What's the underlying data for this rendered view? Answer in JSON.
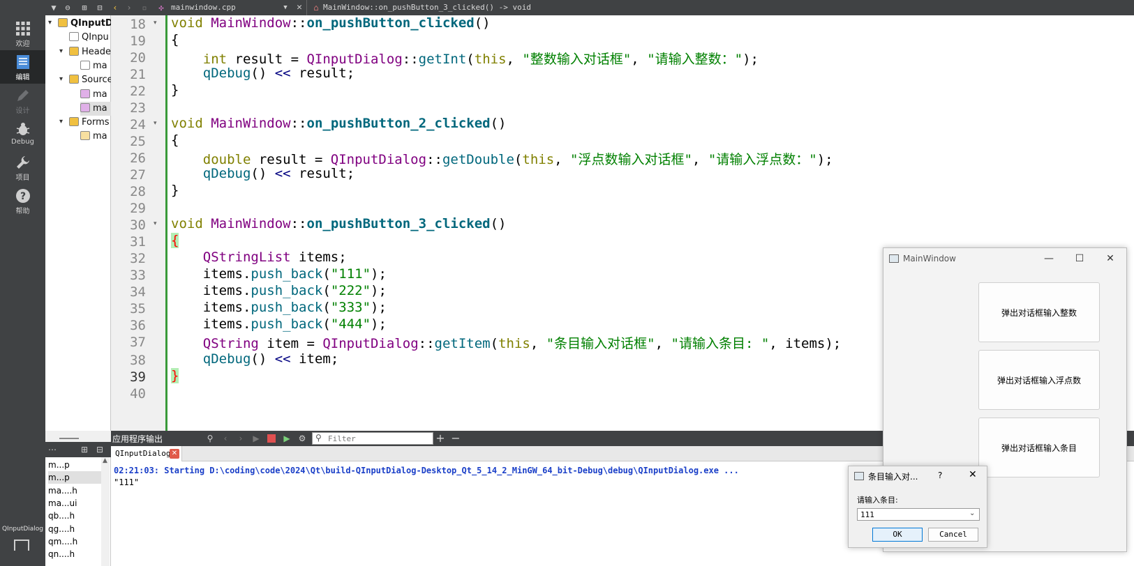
{
  "modes": [
    {
      "label": "欢迎",
      "icon": "grid-icon"
    },
    {
      "label": "编辑",
      "icon": "edit-document-icon"
    },
    {
      "label": "设计",
      "icon": "pencil-icon"
    },
    {
      "label": "Debug",
      "icon": "bug-icon"
    },
    {
      "label": "项目",
      "icon": "wrench-icon"
    },
    {
      "label": "帮助",
      "icon": "help-icon"
    }
  ],
  "mode_kit_label": "QInputDialog",
  "topbar": {
    "file_name": "mainwindow.cpp",
    "symbol": "MainWindow::on_pushButton_3_clicked() -> void"
  },
  "tree": [
    {
      "label": "QInputD",
      "indent": 0,
      "arrow": "▾",
      "icon": "project-icon"
    },
    {
      "label": "QInpu",
      "indent": 1,
      "arrow": "",
      "icon": "pro-file-icon"
    },
    {
      "label": "Heade",
      "indent": 1,
      "arrow": "▾",
      "icon": "folder-icon"
    },
    {
      "label": "ma",
      "indent": 2,
      "arrow": "",
      "icon": "header-file-icon"
    },
    {
      "label": "Source",
      "indent": 1,
      "arrow": "▾",
      "icon": "folder-icon"
    },
    {
      "label": "ma",
      "indent": 2,
      "arrow": "",
      "icon": "cpp-file-icon"
    },
    {
      "label": "ma",
      "indent": 2,
      "arrow": "",
      "icon": "cpp-file-icon"
    },
    {
      "label": "Forms",
      "indent": 1,
      "arrow": "▾",
      "icon": "folder-icon"
    },
    {
      "label": "ma",
      "indent": 2,
      "arrow": "",
      "icon": "ui-file-icon"
    }
  ],
  "line_numbers": [
    "18",
    "19",
    "20",
    "21",
    "22",
    "23",
    "24",
    "25",
    "26",
    "27",
    "28",
    "29",
    "30",
    "31",
    "32",
    "33",
    "34",
    "35",
    "36",
    "37",
    "38",
    "39",
    "40"
  ],
  "code": {
    "l18_kw": "void",
    "l18_cls": "MainWindow",
    "l18_sep": "::",
    "l18_fn": "on_pushButton_clicked",
    "l18_end": "()",
    "l19": "{",
    "l20_kw": "int",
    "l20_a": " result = ",
    "l20_cls": "QInputDialog",
    "l20_sep": "::",
    "l20_fn": "getInt",
    "l20_b": "(",
    "l20_this": "this",
    "l20_c": ", ",
    "l20_s1": "\"整数输入对话框\"",
    "l20_d": ", ",
    "l20_s2": "\"请输入整数：\"",
    "l20_e": ");",
    "l21_fn": "qDebug",
    "l21_a": "() ",
    "l21_op": "<<",
    "l21_b": " result;",
    "l22": "}",
    "l24_kw": "void",
    "l24_cls": "MainWindow",
    "l24_sep": "::",
    "l24_fn": "on_pushButton_2_clicked",
    "l24_end": "()",
    "l25": "{",
    "l26_kw": "double",
    "l26_a": " result = ",
    "l26_cls": "QInputDialog",
    "l26_sep": "::",
    "l26_fn": "getDouble",
    "l26_b": "(",
    "l26_this": "this",
    "l26_c": ", ",
    "l26_s1": "\"浮点数输入对话框\"",
    "l26_d": ", ",
    "l26_s2": "\"请输入浮点数：\"",
    "l26_e": ");",
    "l27_fn": "qDebug",
    "l27_a": "() ",
    "l27_op": "<<",
    "l27_b": " result;",
    "l28": "}",
    "l30_kw": "void",
    "l30_cls": "MainWindow",
    "l30_sep": "::",
    "l30_fn": "on_pushButton_3_clicked",
    "l30_end": "()",
    "l31": "{",
    "l32_cls": "QStringList",
    "l32_a": " items;",
    "l33_a": "items.",
    "l33_fn": "push_back",
    "l33_b": "(",
    "l33_s": "\"111\"",
    "l33_c": ");",
    "l34_a": "items.",
    "l34_fn": "push_back",
    "l34_b": "(",
    "l34_s": "\"222\"",
    "l34_c": ");",
    "l35_a": "items.",
    "l35_fn": "push_back",
    "l35_b": "(",
    "l35_s": "\"333\"",
    "l35_c": ");",
    "l36_a": "items.",
    "l36_fn": "push_back",
    "l36_b": "(",
    "l36_s": "\"444\"",
    "l36_c": ");",
    "l37_cls": "QString",
    "l37_a": " item = ",
    "l37_cls2": "QInputDialog",
    "l37_sep": "::",
    "l37_fn": "getItem",
    "l37_b": "(",
    "l37_this": "this",
    "l37_c": ", ",
    "l37_s1": "\"条目输入对话框\"",
    "l37_d": ", ",
    "l37_s2": "\"请输入条目: \"",
    "l37_e": ", items);",
    "l38_fn": "qDebug",
    "l38_a": "() ",
    "l38_op": "<<",
    "l38_b": " item;",
    "l39": "}"
  },
  "output": {
    "pane_title": "应用程序输出",
    "filter_placeholder": "Filter",
    "tab_label": "QInputDialog",
    "line1": "02:21:03: Starting D:\\coding\\code\\2024\\Qt\\build-QInputDialog-Desktop_Qt_5_14_2_MinGW_64_bit-Debug\\debug\\QInputDialog.exe ...",
    "line2": "\"111\""
  },
  "open_docs": [
    "m...p",
    "m...p",
    "ma....h",
    "ma...ui",
    "qb....h",
    "qg....h",
    "qm....h",
    "qn....h"
  ],
  "main_window": {
    "title": "MainWindow",
    "buttons": [
      "弹出对话框输入整数",
      "弹出对话框输入浮点数",
      "弹出对话框输入条目"
    ]
  },
  "dialog": {
    "title": "条目输入对...",
    "help": "?",
    "label": "请输入条目:",
    "selected": "111",
    "ok": "OK",
    "cancel": "Cancel"
  },
  "colors": {
    "keyword": "#808000",
    "class": "#800080",
    "function": "#00677c",
    "string": "#008000",
    "dark_panel": "#404244"
  }
}
